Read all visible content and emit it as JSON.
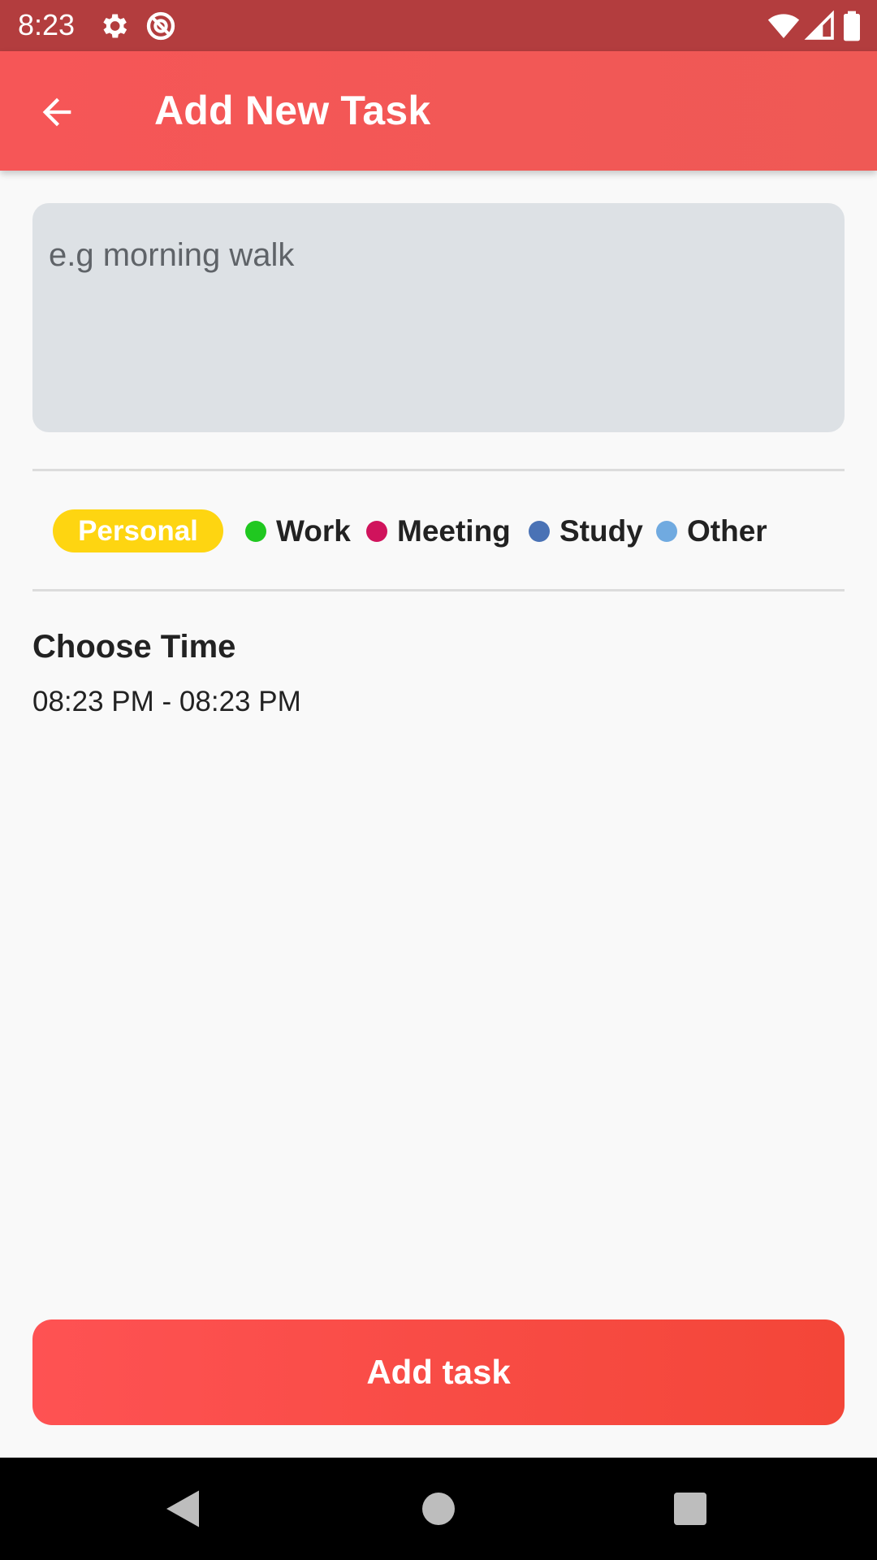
{
  "status_bar": {
    "time": "8:23",
    "icons": [
      "settings-icon",
      "no-disturb-icon",
      "wifi-icon",
      "signal-icon",
      "battery-icon"
    ]
  },
  "app_bar": {
    "back_icon": "arrow-back-icon",
    "title": "Add New Task",
    "color": "#f65657"
  },
  "task_input": {
    "placeholder": "e.g morning walk",
    "value": ""
  },
  "categories": {
    "selected": "Personal",
    "items": [
      {
        "label": "Personal",
        "color": "#fed511"
      },
      {
        "label": "Work",
        "color": "#20c820"
      },
      {
        "label": "Meeting",
        "color": "#d0135c"
      },
      {
        "label": "Study",
        "color": "#4a72b5"
      },
      {
        "label": "Other",
        "color": "#70aae0"
      }
    ]
  },
  "time_section": {
    "heading": "Choose Time",
    "value": "08:23 PM - 08:23 PM"
  },
  "add_button": {
    "label": "Add task",
    "color": "#fe5253"
  },
  "nav_bar": {
    "buttons": [
      "back-triangle-icon",
      "home-circle-icon",
      "recents-square-icon"
    ]
  }
}
